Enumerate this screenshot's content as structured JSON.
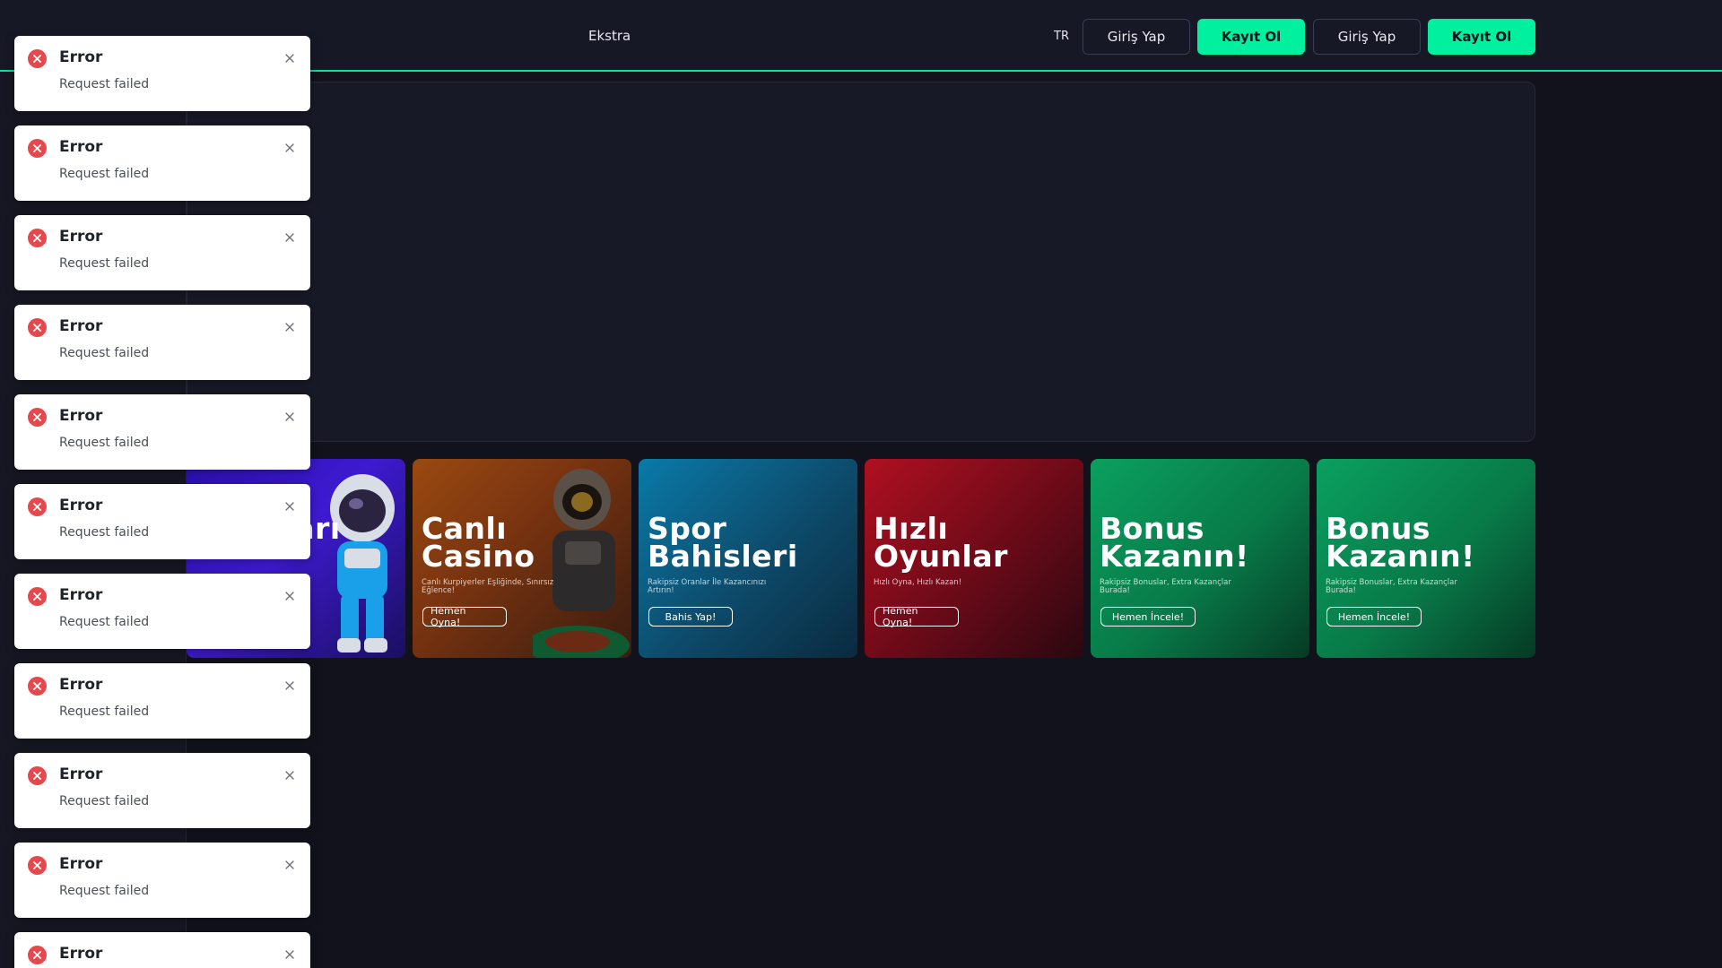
{
  "header": {
    "nav_extra": "Ekstra",
    "lang": "TR",
    "buttons": {
      "login_1": "Giriş Yap",
      "register_1": "Kayıt Ol",
      "login_2": "Giriş Yap",
      "register_2": "Kayıt Ol"
    },
    "accent_color": "#00f0a0"
  },
  "cards": [
    {
      "title_line1": "",
      "title_line2": "Oyunları",
      "subtitle": "",
      "cta": ""
    },
    {
      "title_line1": "Canlı",
      "title_line2": "Casino",
      "subtitle": "Canlı Kurpiyerler Eşliğinde, Sınırsız Eğlence!",
      "cta": "Hemen Oyna!"
    },
    {
      "title_line1": "Spor",
      "title_line2": "Bahisleri",
      "subtitle": "Rakipsiz Oranlar İle Kazancınızı Artırın!",
      "cta": "Bahis Yap!"
    },
    {
      "title_line1": "Hızlı",
      "title_line2": "Oyunlar",
      "subtitle": "Hızlı Oyna, Hızlı Kazan!",
      "cta": "Hemen Oyna!"
    },
    {
      "title_line1": "Bonus",
      "title_line2": "Kazanın!",
      "subtitle": "Rakipsiz Bonuslar, Extra Kazançlar Burada!",
      "cta": "Hemen İncele!"
    },
    {
      "title_line1": "Bonus",
      "title_line2": "Kazanın!",
      "subtitle": "Rakipsiz Bonuslar, Extra Kazançlar Burada!",
      "cta": "Hemen İncele!"
    }
  ],
  "toasts": [
    {
      "title": "Error",
      "message": "Request failed"
    },
    {
      "title": "Error",
      "message": "Request failed"
    },
    {
      "title": "Error",
      "message": "Request failed"
    },
    {
      "title": "Error",
      "message": "Request failed"
    },
    {
      "title": "Error",
      "message": "Request failed"
    },
    {
      "title": "Error",
      "message": "Request failed"
    },
    {
      "title": "Error",
      "message": "Request failed"
    },
    {
      "title": "Error",
      "message": "Request failed"
    },
    {
      "title": "Error",
      "message": "Request failed"
    },
    {
      "title": "Error",
      "message": "Request failed"
    },
    {
      "title": "Error",
      "message": ""
    }
  ],
  "colors": {
    "error": "#e5484d",
    "background": "#12121c"
  }
}
